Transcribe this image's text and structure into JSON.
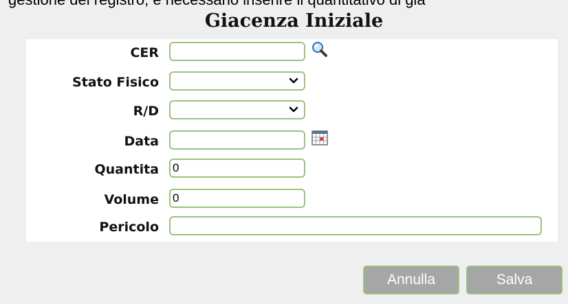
{
  "header": {
    "clipped_text": "gestione del registro, è necessario inserire il quantitativo di gia",
    "title": "Giacenza Iniziale"
  },
  "form": {
    "cer": {
      "label": "CER",
      "value": "",
      "icon": "search-icon"
    },
    "stato_fisico": {
      "label": "Stato Fisico",
      "value": ""
    },
    "rd": {
      "label": "R/D",
      "value": ""
    },
    "data": {
      "label": "Data",
      "value": "",
      "icon": "calendar-icon"
    },
    "quantita": {
      "label": "Quantita",
      "value": "0"
    },
    "volume": {
      "label": "Volume",
      "value": "0"
    },
    "pericolo": {
      "label": "Pericolo",
      "value": ""
    }
  },
  "actions": {
    "cancel_label": "Annulla",
    "save_label": "Salva"
  },
  "colors": {
    "field_border": "#9bc27d",
    "button_bg": "#a6a6a6",
    "page_bg": "#efefef",
    "panel_bg": "#ffffff"
  }
}
